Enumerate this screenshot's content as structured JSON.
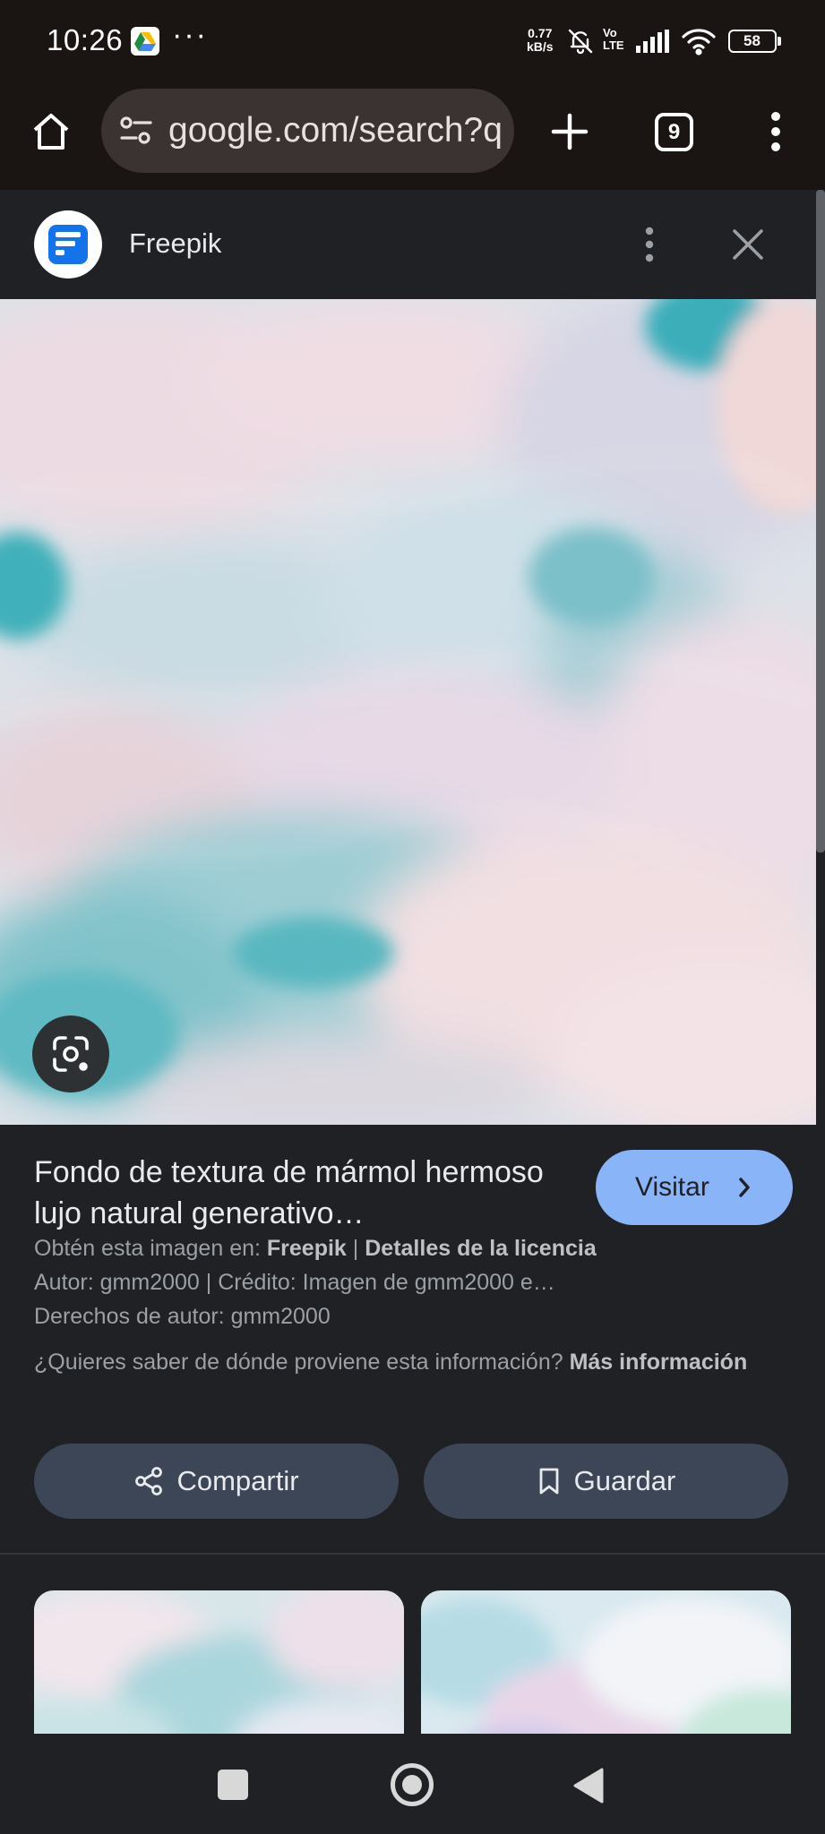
{
  "status_bar": {
    "time": "10:26",
    "dots": "···",
    "net_speed_value": "0.77",
    "net_speed_unit": "kB/s",
    "volte_top": "Vo",
    "volte_bottom": "LTE",
    "battery": "58",
    "icons": [
      "google-drive-icon",
      "bell-off-icon",
      "signal-icon",
      "wifi-icon",
      "battery-icon"
    ]
  },
  "browser": {
    "url": "google.com/search?q",
    "tab_count": "9",
    "icons": [
      "home-icon",
      "tune-icon",
      "plus-icon",
      "more-vert-icon"
    ]
  },
  "source": {
    "name": "Freepik",
    "icons": [
      "freepik-logo",
      "more-vert-icon",
      "close-icon"
    ]
  },
  "image": {
    "description_colors": [
      "#dcd7e3",
      "#7ec3cc",
      "#f1dde0"
    ],
    "lens_icon": "google-lens-icon"
  },
  "info": {
    "title": "Fondo de textura de mármol hermoso lujo natural generativo…",
    "visit_label": "Visitar",
    "obtain_prefix": "Obtén esta imagen en:",
    "obtain_source": "Freepik",
    "separator": "|",
    "license_link": "Detalles de la licencia",
    "author_line": "Autor: gmm2000 | Crédito: Imagen de gmm2000 e…",
    "copyright_line": "Derechos de autor: gmm2000",
    "question": "¿Quieres saber de dónde proviene esta información?",
    "more_info": "Más información",
    "share_label": "Compartir",
    "save_label": "Guardar"
  },
  "colors": {
    "accent": "#8ab4f8",
    "background": "#202124",
    "button": "#3c4657"
  }
}
